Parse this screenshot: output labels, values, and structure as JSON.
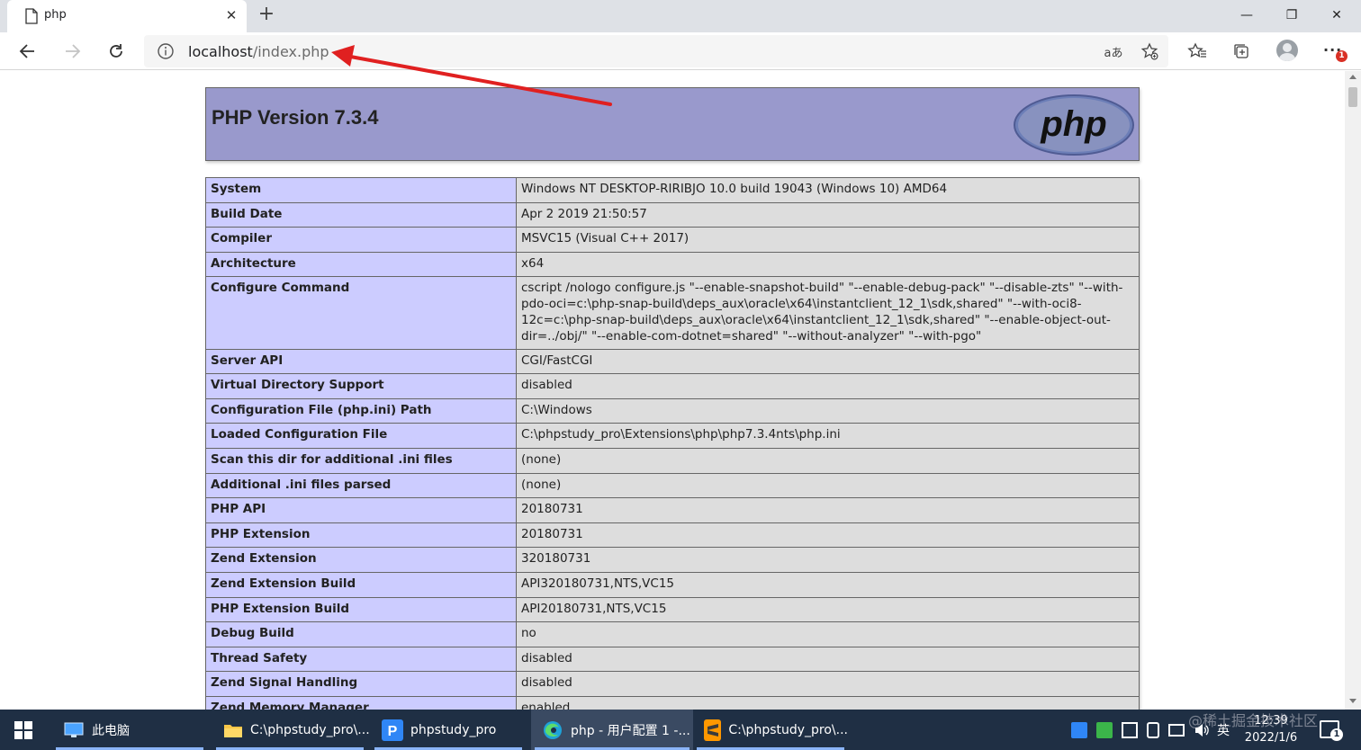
{
  "browser": {
    "tab_title": "php",
    "tab_close": "✕",
    "new_tab": "+",
    "url_host": "localhost",
    "url_path": "/index.php",
    "read_aloud": "aあ",
    "window_controls": {
      "minimize": "—",
      "restore": "❐",
      "close": "✕"
    },
    "more_label": "···",
    "notification_badge": "1"
  },
  "php": {
    "title": "PHP Version 7.3.4",
    "logo_text": "php",
    "rows": [
      {
        "key": "System",
        "value": "Windows NT DESKTOP-RIRIBJO 10.0 build 19043 (Windows 10) AMD64"
      },
      {
        "key": "Build Date",
        "value": "Apr 2 2019 21:50:57"
      },
      {
        "key": "Compiler",
        "value": "MSVC15 (Visual C++ 2017)"
      },
      {
        "key": "Architecture",
        "value": "x64"
      },
      {
        "key": "Configure Command",
        "value": "cscript /nologo configure.js \"--enable-snapshot-build\" \"--enable-debug-pack\" \"--disable-zts\" \"--with-pdo-oci=c:\\php-snap-build\\deps_aux\\oracle\\x64\\instantclient_12_1\\sdk,shared\" \"--with-oci8-12c=c:\\php-snap-build\\deps_aux\\oracle\\x64\\instantclient_12_1\\sdk,shared\" \"--enable-object-out-dir=../obj/\" \"--enable-com-dotnet=shared\" \"--without-analyzer\" \"--with-pgo\""
      },
      {
        "key": "Server API",
        "value": "CGI/FastCGI"
      },
      {
        "key": "Virtual Directory Support",
        "value": "disabled"
      },
      {
        "key": "Configuration File (php.ini) Path",
        "value": "C:\\Windows"
      },
      {
        "key": "Loaded Configuration File",
        "value": "C:\\phpstudy_pro\\Extensions\\php\\php7.3.4nts\\php.ini"
      },
      {
        "key": "Scan this dir for additional .ini files",
        "value": "(none)"
      },
      {
        "key": "Additional .ini files parsed",
        "value": "(none)"
      },
      {
        "key": "PHP API",
        "value": "20180731"
      },
      {
        "key": "PHP Extension",
        "value": "20180731"
      },
      {
        "key": "Zend Extension",
        "value": "320180731"
      },
      {
        "key": "Zend Extension Build",
        "value": "API320180731,NTS,VC15"
      },
      {
        "key": "PHP Extension Build",
        "value": "API20180731,NTS,VC15"
      },
      {
        "key": "Debug Build",
        "value": "no"
      },
      {
        "key": "Thread Safety",
        "value": "disabled"
      },
      {
        "key": "Zend Signal Handling",
        "value": "disabled"
      },
      {
        "key": "Zend Memory Manager",
        "value": "enabled"
      }
    ]
  },
  "taskbar": {
    "items": [
      {
        "label": "此电脑",
        "icon": "computer-icon"
      },
      {
        "label": "C:\\phpstudy_pro\\...",
        "icon": "folder-icon"
      },
      {
        "label": "phpstudy_pro",
        "icon": "phpstudy-icon"
      },
      {
        "label": "php - 用户配置 1 -...",
        "icon": "edge-icon"
      },
      {
        "label": "C:\\phpstudy_pro\\...",
        "icon": "sublime-icon"
      }
    ],
    "ime": "英",
    "time": "12:39",
    "date": "2022/1/6",
    "notification_count": "1",
    "watermark": "@稀土掘金技术社区"
  },
  "colors": {
    "php_header": "#9999cc",
    "key_cell": "#ccccff",
    "value_cell": "#dddddd",
    "annotation_arrow": "#e02020",
    "taskbar": "#1f2f44"
  }
}
